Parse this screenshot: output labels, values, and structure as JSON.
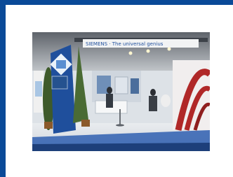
{
  "frame": {
    "color": "#0a4a98"
  },
  "photo": {
    "banner_text": "SIEMENS · The universal genius",
    "accent_colors": {
      "blue": "#1f4f9c",
      "green": "#3e5a2a",
      "red": "#b02828"
    }
  }
}
